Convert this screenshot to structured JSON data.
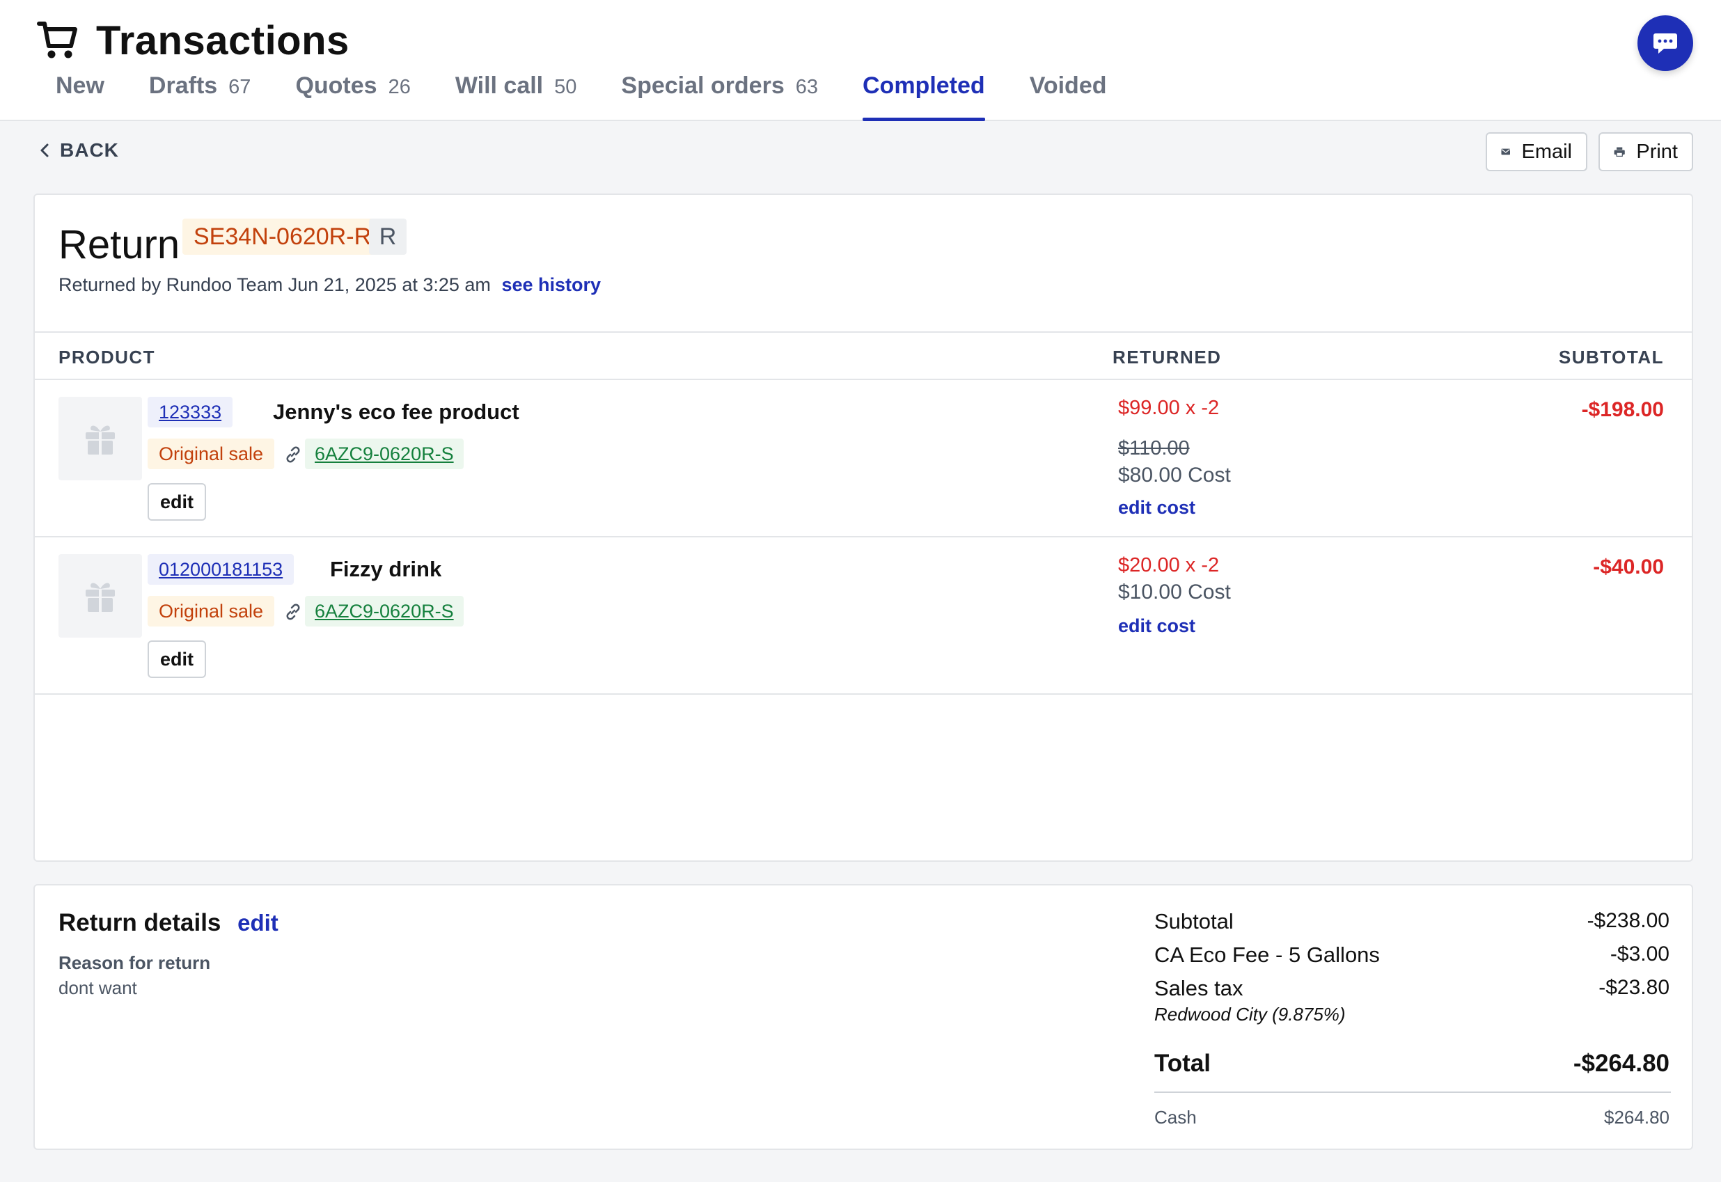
{
  "header": {
    "title": "Transactions",
    "tabs": [
      {
        "label": "New",
        "count": ""
      },
      {
        "label": "Drafts",
        "count": "67"
      },
      {
        "label": "Quotes",
        "count": "26"
      },
      {
        "label": "Will call",
        "count": "50"
      },
      {
        "label": "Special orders",
        "count": "63"
      },
      {
        "label": "Completed",
        "count": ""
      },
      {
        "label": "Voided",
        "count": ""
      }
    ],
    "active_tab": "Completed"
  },
  "toolbar": {
    "back_label": "BACK",
    "email_label": "Email",
    "print_label": "Print"
  },
  "transaction": {
    "type": "Return",
    "id": "SE34N-0620R-R",
    "badge": "R",
    "returned_by": "Returned by Rundoo Team Jun 21, 2025 at 3:25 am",
    "see_history": "see history"
  },
  "table": {
    "columns": [
      "PRODUCT",
      "RETURNED",
      "SUBTOTAL"
    ],
    "rows": [
      {
        "sku": "123333",
        "name": "Jenny's eco fee product",
        "original_sale_label": "Original sale",
        "original_sale_id": "6AZC9-0620R-S",
        "edit_label": "edit",
        "price_qty": "$99.00 x -2",
        "original_price": "$110.00",
        "cost": "$80.00 Cost",
        "edit_cost_label": "edit cost",
        "subtotal": "-$198.00"
      },
      {
        "sku": "012000181153",
        "name": "Fizzy drink",
        "original_sale_label": "Original sale",
        "original_sale_id": "6AZC9-0620R-S",
        "edit_label": "edit",
        "price_qty": "$20.00 x -2",
        "cost": "$10.00 Cost",
        "edit_cost_label": "edit cost",
        "subtotal": "-$40.00"
      }
    ]
  },
  "return_details": {
    "title": "Return details",
    "edit_label": "edit",
    "reason_label": "Reason for return",
    "reason_value": "dont want"
  },
  "summary": {
    "lines": [
      {
        "label": "Subtotal",
        "value": "-$238.00"
      },
      {
        "label": "CA Eco Fee - 5 Gallons",
        "value": "-$3.00"
      },
      {
        "label": "Sales tax",
        "value": "-$23.80"
      }
    ],
    "tax_note": "Redwood City (9.875%)",
    "total_label": "Total",
    "total_value": "-$264.80",
    "payment_label": "Cash",
    "payment_value": "$264.80"
  },
  "colors": {
    "accent": "#1e2fb6",
    "negative": "#dc2626",
    "id_badge_text": "#c2410c",
    "link_green": "#15803d"
  },
  "icons": [
    "shopping-cart-icon",
    "chat-icon",
    "chevron-left-icon",
    "envelope-icon",
    "printer-icon",
    "gift-icon",
    "link-icon"
  ]
}
